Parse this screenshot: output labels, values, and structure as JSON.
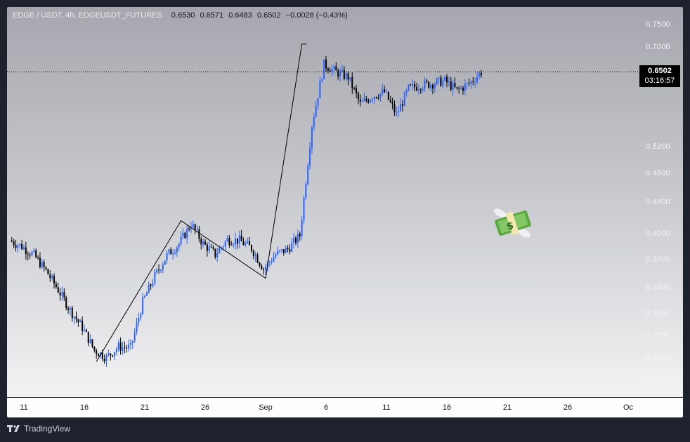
{
  "legend": {
    "symbol": "EDGE / USDT, 4h, EDGEUSDT_FUTURES",
    "open": "0.6530",
    "high": "0.6571",
    "low": "0.6483",
    "close": "0.6502",
    "change": "−0.0028 (−0.43%)"
  },
  "last_price": {
    "price": "0.6502",
    "countdown": "03:16:57"
  },
  "footer": {
    "brand": "TradingView"
  },
  "colors": {
    "up": "#2962ff",
    "down": "#000000",
    "background_top": "#a6a7ae",
    "background_bottom": "#f3f3f4"
  },
  "icons": {
    "sticker": "money-with-wings-icon",
    "logo": "tradingview-logo-icon"
  },
  "chart_data": {
    "type": "candlestick",
    "symbol": "EDGE / USDT",
    "interval": "4h",
    "y_scale": "log",
    "ylim": [
      0.245,
      0.79
    ],
    "y_ticks": [
      "0.7500",
      "0.7000",
      "0.5200",
      "0.4800",
      "0.4400",
      "0.4000",
      "0.3700",
      "0.3400",
      "0.3150",
      "0.2950",
      "0.2750",
      "0.2570"
    ],
    "x_ticks": [
      "11",
      "16",
      "21",
      "26",
      "Sep",
      "6",
      "11",
      "16",
      "21",
      "26",
      "Oc"
    ],
    "last_price": 0.6502,
    "price_series": [
      [
        "Aug 10",
        0.392
      ],
      [
        "Aug 11",
        0.385
      ],
      [
        "Aug 12",
        0.375
      ],
      [
        "Aug 13",
        0.358
      ],
      [
        "Aug 14",
        0.338
      ],
      [
        "Aug 15",
        0.318
      ],
      [
        "Aug 16",
        0.302
      ],
      [
        "Aug 17",
        0.282
      ],
      [
        "Aug 18",
        0.276
      ],
      [
        "Aug 19",
        0.285
      ],
      [
        "Aug 20",
        0.284
      ],
      [
        "Aug 21",
        0.326
      ],
      [
        "Aug 22",
        0.352
      ],
      [
        "Aug 23",
        0.375
      ],
      [
        "Aug 24",
        0.388
      ],
      [
        "Aug 25",
        0.412
      ],
      [
        "Aug 26",
        0.388
      ],
      [
        "Aug 27",
        0.376
      ],
      [
        "Aug 28",
        0.393
      ],
      [
        "Aug 29",
        0.392
      ],
      [
        "Aug 30",
        0.383
      ],
      [
        "Aug 31",
        0.36
      ],
      [
        "Sep 1",
        0.376
      ],
      [
        "Sep 2",
        0.382
      ],
      [
        "Sep 3",
        0.398
      ],
      [
        "Sep 4",
        0.555
      ],
      [
        "Sep 5",
        0.665
      ],
      [
        "Sep 6",
        0.65
      ],
      [
        "Sep 7",
        0.64
      ],
      [
        "Sep 8",
        0.59
      ],
      [
        "Sep 9",
        0.605
      ],
      [
        "Sep 10",
        0.612
      ],
      [
        "Sep 11",
        0.572
      ],
      [
        "Sep 12",
        0.618
      ],
      [
        "Sep 13",
        0.625
      ],
      [
        "Sep 14",
        0.628
      ],
      [
        "Sep 15",
        0.633
      ],
      [
        "Sep 16",
        0.615
      ],
      [
        "Sep 17",
        0.627
      ],
      [
        "Sep 18",
        0.65
      ]
    ],
    "trend_lines": [
      [
        "Aug 17",
        0.2725
      ],
      [
        "Aug 24",
        0.416
      ],
      [
        "Aug 31",
        0.35
      ],
      [
        "Sep 3",
        0.707
      ],
      [
        "Sep 3.4",
        0.707
      ]
    ]
  }
}
